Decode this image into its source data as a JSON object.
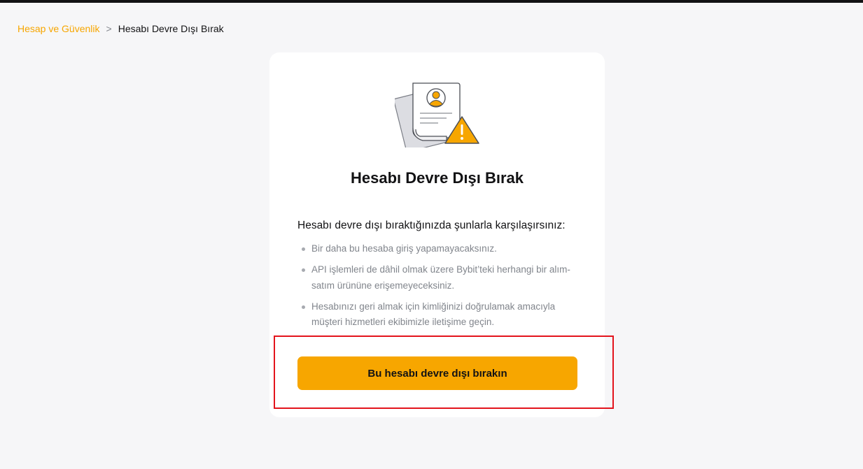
{
  "breadcrumb": {
    "parent": "Hesap ve Güvenlik",
    "separator": ">",
    "current": "Hesabı Devre Dışı Bırak"
  },
  "card": {
    "icon": "document-warning-icon",
    "title": "Hesabı Devre Dışı Bırak",
    "intro": "Hesabı devre dışı bıraktığınızda şunlarla karşılaşırsınız:",
    "reasons": [
      "Bir daha bu hesaba giriş yapamayacaksınız.",
      "API işlemleri de dâhil olmak üzere Bybit’teki herhangi bir alım-satım ürününe erişemeyeceksiniz.",
      "Hesabınızı geri almak için kimliğinizi doğrulamak amacıyla müşteri hizmetleri ekibimizle iletişime geçin."
    ],
    "button_label": "Bu hesabı devre dışı bırakın"
  },
  "colors": {
    "accent": "#f7a600",
    "highlight": "#e3141c",
    "background": "#f6f6f8"
  }
}
